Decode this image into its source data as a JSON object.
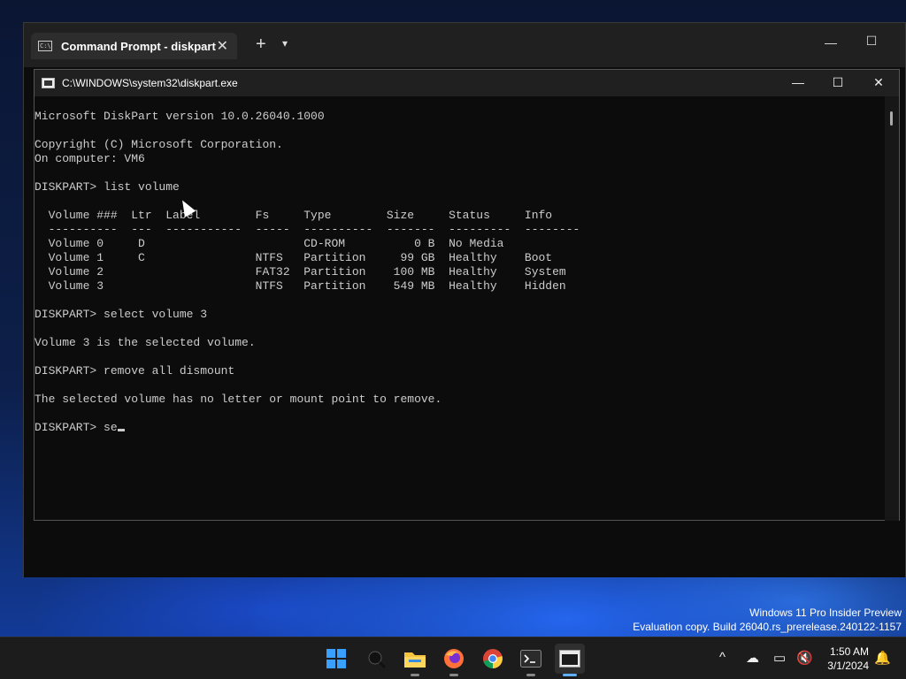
{
  "terminal": {
    "tab_title": "Command Prompt - diskpart",
    "tab_icon_text": "C:\\",
    "new_tab": "+",
    "dropdown": "⌄",
    "minimize": "—",
    "maximize": "☐"
  },
  "conhost": {
    "title": "C:\\WINDOWS\\system32\\diskpart.exe",
    "minimize": "—",
    "maximize": "☐",
    "close": "✕"
  },
  "console_lines": [
    "Microsoft DiskPart version 10.0.26040.1000",
    "",
    "Copyright (C) Microsoft Corporation.",
    "On computer: VM6",
    "",
    "DISKPART> list volume",
    "",
    "  Volume ###  Ltr  Label        Fs     Type        Size     Status     Info",
    "  ----------  ---  -----------  -----  ----------  -------  ---------  --------",
    "  Volume 0     D                       CD-ROM          0 B  No Media",
    "  Volume 1     C                NTFS   Partition     99 GB  Healthy    Boot",
    "  Volume 2                      FAT32  Partition    100 MB  Healthy    System",
    "  Volume 3                      NTFS   Partition    549 MB  Healthy    Hidden",
    "",
    "DISKPART> select volume 3",
    "",
    "Volume 3 is the selected volume.",
    "",
    "DISKPART> remove all dismount",
    "",
    "The selected volume has no letter or mount point to remove.",
    "",
    "DISKPART> se"
  ],
  "watermark": {
    "line1": "Windows 11 Pro Insider Preview",
    "line2": "Evaluation copy. Build 26040.rs_prerelease.240122-1157"
  },
  "taskbar": {
    "apps": [
      "start-icon",
      "search-icon",
      "file-explorer-icon",
      "firefox-icon",
      "chrome-icon",
      "terminal-icon",
      "console-window-icon"
    ],
    "tray_chevron": "^",
    "time": "1:50 AM",
    "date": "3/1/2024"
  },
  "colors": {
    "console_text": "#cccccc",
    "console_bg": "#0c0c0c",
    "taskbar_bg": "#1c1c1c",
    "accent": "#60b0ff"
  }
}
